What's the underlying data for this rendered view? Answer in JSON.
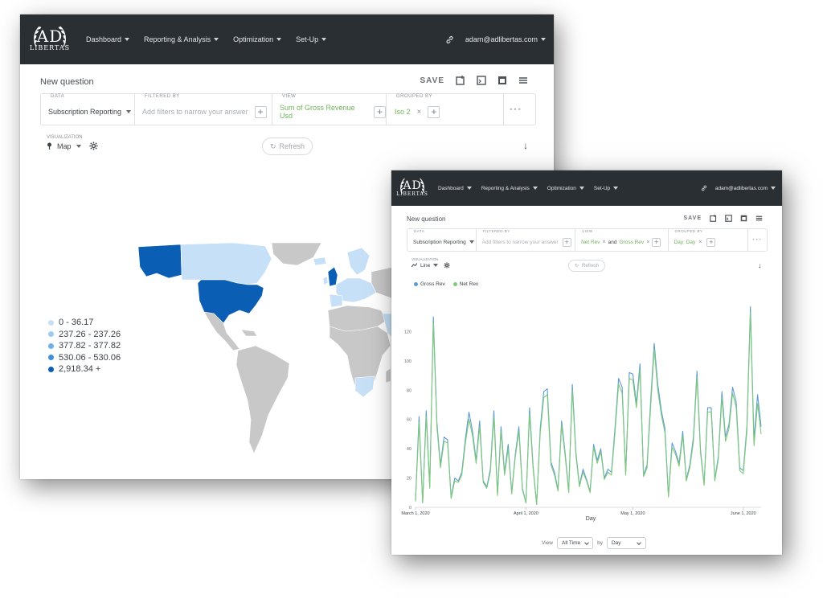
{
  "nav": {
    "logo_top": "AD",
    "logo_bottom": "LIBERTAS",
    "items": [
      "Dashboard",
      "Reporting & Analysis",
      "Optimization",
      "Set-Up"
    ],
    "user": "adam@adlibertas.com"
  },
  "map_window": {
    "title": "New question",
    "save": "SAVE",
    "data_label": "DATA",
    "data_value": "Subscription Reporting",
    "filter_label": "FILTERED BY",
    "filter_placeholder": "Add filters to narrow your answer",
    "view_label": "VIEW",
    "view_value": "Sum of Gross Revenue Usd",
    "group_label": "GROUPED BY",
    "group_value": "Iso 2",
    "vis_label": "VISUALIZATION",
    "vis_value": "Map",
    "refresh": "Refresh",
    "legend": [
      {
        "label": "0 - 36.17",
        "color": "#c6e0f7"
      },
      {
        "label": "237.26 - 237.26",
        "color": "#9ccbf2"
      },
      {
        "label": "377.82 - 377.82",
        "color": "#6fb0ea"
      },
      {
        "label": "530.06 - 530.06",
        "color": "#3f8fdc"
      },
      {
        "label": "2,918.34 +",
        "color": "#0a5fb4"
      }
    ]
  },
  "chart_window": {
    "title": "New question",
    "save": "SAVE",
    "data_label": "DATA",
    "data_value": "Subscription Reporting",
    "filter_label": "FILTERED BY",
    "filter_placeholder": "Add filters to narrow your answer",
    "view_label": "VIEW",
    "view_value_1": "Net Rev",
    "view_and": "and",
    "view_value_2": "Gross Rev",
    "group_label": "GROUPED BY",
    "group_value": "Day: Day",
    "vis_label": "VISUALIZATION",
    "vis_value": "Line",
    "refresh": "Refresh",
    "footer_view": "View",
    "footer_range": "All Time",
    "footer_by": "by",
    "footer_unit": "Day"
  },
  "chart_data": {
    "type": "line",
    "xlabel": "Day",
    "ylabel": "",
    "ylim": [
      0,
      140
    ],
    "yticks": [
      0,
      20,
      40,
      60,
      80,
      100,
      120
    ],
    "xtick_labels": [
      "March 1, 2020",
      "April 1, 2020",
      "May 1, 2020",
      "June 1, 2020"
    ],
    "xtick_days": [
      0,
      31,
      61,
      92
    ],
    "series": [
      {
        "name": "Gross Rev",
        "color": "#5b9bd5",
        "values": [
          5,
          62,
          3,
          66,
          14,
          130,
          58,
          29,
          48,
          46,
          7,
          20,
          18,
          24,
          47,
          65,
          52,
          32,
          59,
          18,
          14,
          26,
          66,
          9,
          55,
          24,
          43,
          10,
          36,
          55,
          13,
          3,
          68,
          28,
          2,
          54,
          79,
          81,
          31,
          24,
          12,
          59,
          37,
          11,
          84,
          38,
          15,
          26,
          19,
          11,
          43,
          32,
          40,
          20,
          26,
          24,
          54,
          88,
          82,
          23,
          92,
          91,
          71,
          98,
          22,
          29,
          73,
          112,
          84,
          66,
          54,
          8,
          44,
          38,
          30,
          52,
          19,
          29,
          48,
          93,
          39,
          16,
          68,
          68,
          19,
          35,
          79,
          48,
          57,
          82,
          72,
          27,
          25,
          55,
          137,
          46,
          77,
          55
        ]
      },
      {
        "name": "Net Rev",
        "color": "#7fc97a",
        "values": [
          4,
          58,
          3,
          62,
          13,
          126,
          55,
          27,
          45,
          44,
          6,
          18,
          17,
          22,
          44,
          60,
          49,
          30,
          55,
          17,
          13,
          24,
          62,
          8,
          52,
          22,
          40,
          9,
          34,
          52,
          12,
          3,
          64,
          26,
          2,
          51,
          75,
          77,
          29,
          22,
          11,
          56,
          35,
          10,
          80,
          36,
          14,
          24,
          18,
          10,
          41,
          30,
          38,
          19,
          24,
          22,
          51,
          84,
          78,
          22,
          88,
          87,
          68,
          94,
          21,
          27,
          69,
          108,
          80,
          63,
          51,
          7,
          41,
          36,
          28,
          49,
          18,
          27,
          45,
          89,
          37,
          15,
          65,
          65,
          18,
          33,
          75,
          45,
          54,
          78,
          68,
          25,
          23,
          52,
          133,
          42,
          71,
          50
        ]
      }
    ]
  }
}
